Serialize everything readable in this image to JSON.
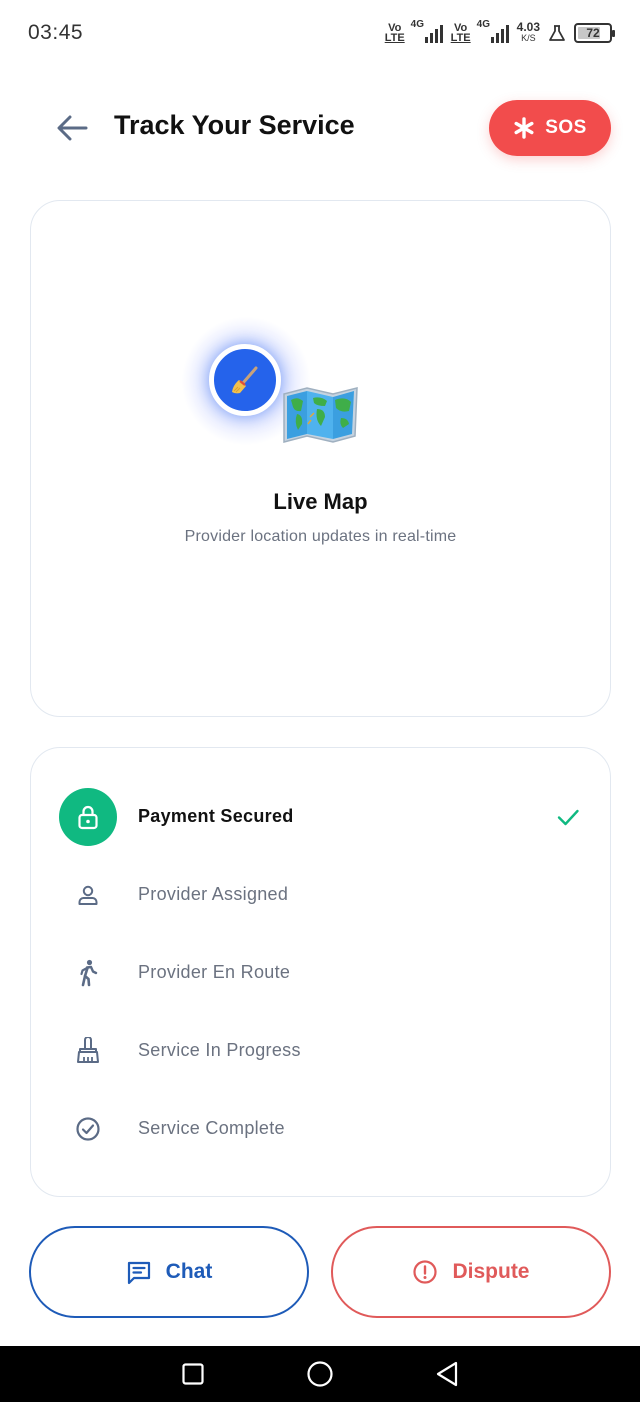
{
  "status_bar": {
    "time": "03:45",
    "net1_top": "Vo",
    "net1_bottom": "LTE",
    "sig1_label": "4G",
    "net2_top": "Vo",
    "net2_bottom": "LTE",
    "sig2_label": "4G",
    "speed_value": "4.03",
    "speed_unit": "K/S",
    "battery_level": "72"
  },
  "header": {
    "title": "Track Your Service",
    "sos_label": "SOS"
  },
  "map": {
    "title": "Live Map",
    "subtitle": "Provider location updates in real-time"
  },
  "steps": [
    {
      "label": "Payment Secured",
      "icon": "lock-icon",
      "active": true,
      "done": true
    },
    {
      "label": "Provider Assigned",
      "icon": "person-icon",
      "active": false,
      "done": false
    },
    {
      "label": "Provider En Route",
      "icon": "walking-icon",
      "active": false,
      "done": false
    },
    {
      "label": "Service In Progress",
      "icon": "broom-icon",
      "active": false,
      "done": false
    },
    {
      "label": "Service Complete",
      "icon": "check-circle-icon",
      "active": false,
      "done": false
    }
  ],
  "actions": {
    "chat_label": "Chat",
    "dispute_label": "Dispute"
  },
  "colors": {
    "sos": "#f24c4c",
    "active_step": "#10b981",
    "chat": "#1e5bb8",
    "dispute": "#e05a5a",
    "pin": "#2563eb"
  }
}
